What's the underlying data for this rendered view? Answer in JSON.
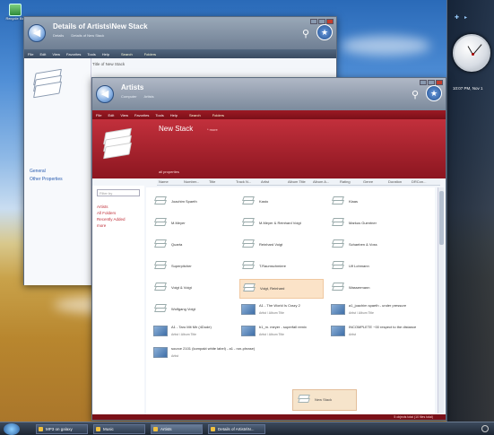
{
  "desktop": {
    "icon_label": "Recycle Bin"
  },
  "sidebar": {
    "time_text": "10:07 PM, Nov 1"
  },
  "back_window": {
    "title": "Details of Artists\\New Stack",
    "breadcrumb": [
      "Details",
      "Details of New Stack"
    ],
    "menu": [
      "File",
      "Edit",
      "View",
      "Favorites",
      "Tools",
      "Help"
    ],
    "toolbar": [
      "Search",
      "Folders"
    ],
    "links": [
      "General",
      "Other Properties"
    ],
    "right_label": "Title of New Stack"
  },
  "front_window": {
    "title": "Artists",
    "breadcrumb": [
      "Computer",
      "Artists"
    ],
    "menu": [
      "File",
      "Edit",
      "View",
      "Favorites",
      "Tools",
      "Help"
    ],
    "toolbar": [
      "Search",
      "Folders"
    ],
    "header": {
      "title": "New Stack",
      "more": "* more",
      "props": "all properties"
    },
    "columns": [
      "Name",
      "Number...",
      "Title",
      "Track N...",
      "Artist",
      "Album Title",
      "Album A...",
      "Rating",
      "Genre",
      "Duration",
      "DRCon..."
    ],
    "filter_placeholder": "Filter by",
    "left_links": [
      "Artists",
      "All Folders",
      "Recently Added",
      "more"
    ],
    "items": [
      {
        "name": "Joachim Spaeth",
        "col": 0,
        "row": 0,
        "thumb": false
      },
      {
        "name": "Kasto",
        "col": 1,
        "row": 0,
        "thumb": false
      },
      {
        "name": "Klaas",
        "col": 2,
        "row": 0,
        "thumb": false
      },
      {
        "name": "M.Meyer",
        "col": 0,
        "row": 1,
        "thumb": false
      },
      {
        "name": "M.Meyer & Reinhard Voigt",
        "col": 1,
        "row": 1,
        "thumb": false
      },
      {
        "name": "Markus Guentner",
        "col": 2,
        "row": 1,
        "thumb": false
      },
      {
        "name": "Quarta",
        "col": 0,
        "row": 2,
        "thumb": false
      },
      {
        "name": "Reinhard Voigt",
        "col": 1,
        "row": 2,
        "thumb": false
      },
      {
        "name": "Schaeben & Voss",
        "col": 2,
        "row": 2,
        "thumb": false
      },
      {
        "name": "Superpitcher",
        "col": 0,
        "row": 3,
        "thumb": false
      },
      {
        "name": "T.Raumschmiere",
        "col": 1,
        "row": 3,
        "thumb": false
      },
      {
        "name": "Ulf Lohmann",
        "col": 2,
        "row": 3,
        "thumb": false
      },
      {
        "name": "Voigt & Voigt",
        "col": 0,
        "row": 4,
        "thumb": false
      },
      {
        "name": "Voigt, Reinhard",
        "col": 1,
        "row": 4,
        "thumb": false,
        "selected": true
      },
      {
        "name": "Wassermann",
        "col": 2,
        "row": 4,
        "thumb": false
      },
      {
        "name": "Wolfgang Voigt",
        "col": 0,
        "row": 5,
        "thumb": false
      },
      {
        "name": "A1 - The World Is Crazy 2",
        "sub": "Artist / Album Title",
        "col": 1,
        "row": 5,
        "thumb": true
      },
      {
        "name": "a1_joachim spaeth - under pressure",
        "sub": "Artist / Album Title",
        "col": 2,
        "row": 5,
        "thumb": true
      },
      {
        "name": "A1 - Taro Mit Mir (4Dude)",
        "sub": "Artist / Album Title",
        "col": 0,
        "row": 6,
        "thumb": true
      },
      {
        "name": "b1_m. meyer - superfall remix",
        "sub": "Artist / Album Title",
        "col": 1,
        "row": 6,
        "thumb": true
      },
      {
        "name": "INCOMPLETE ~00 respect to the distance",
        "sub": "Artist",
        "col": 2,
        "row": 6,
        "thumb": true
      },
      {
        "name": "source 2101 (kompakt white label) - a1 - ron-phrase)",
        "sub": "Artist",
        "col": 0,
        "row": 7,
        "thumb": true
      }
    ],
    "drag_item": "New Stack",
    "status": "5 objects total (10 files total)"
  },
  "taskbar": {
    "buttons": [
      "MP3 on galaxy",
      "Music",
      "Artists",
      "Details of Artists\\N..."
    ],
    "active": 2
  }
}
